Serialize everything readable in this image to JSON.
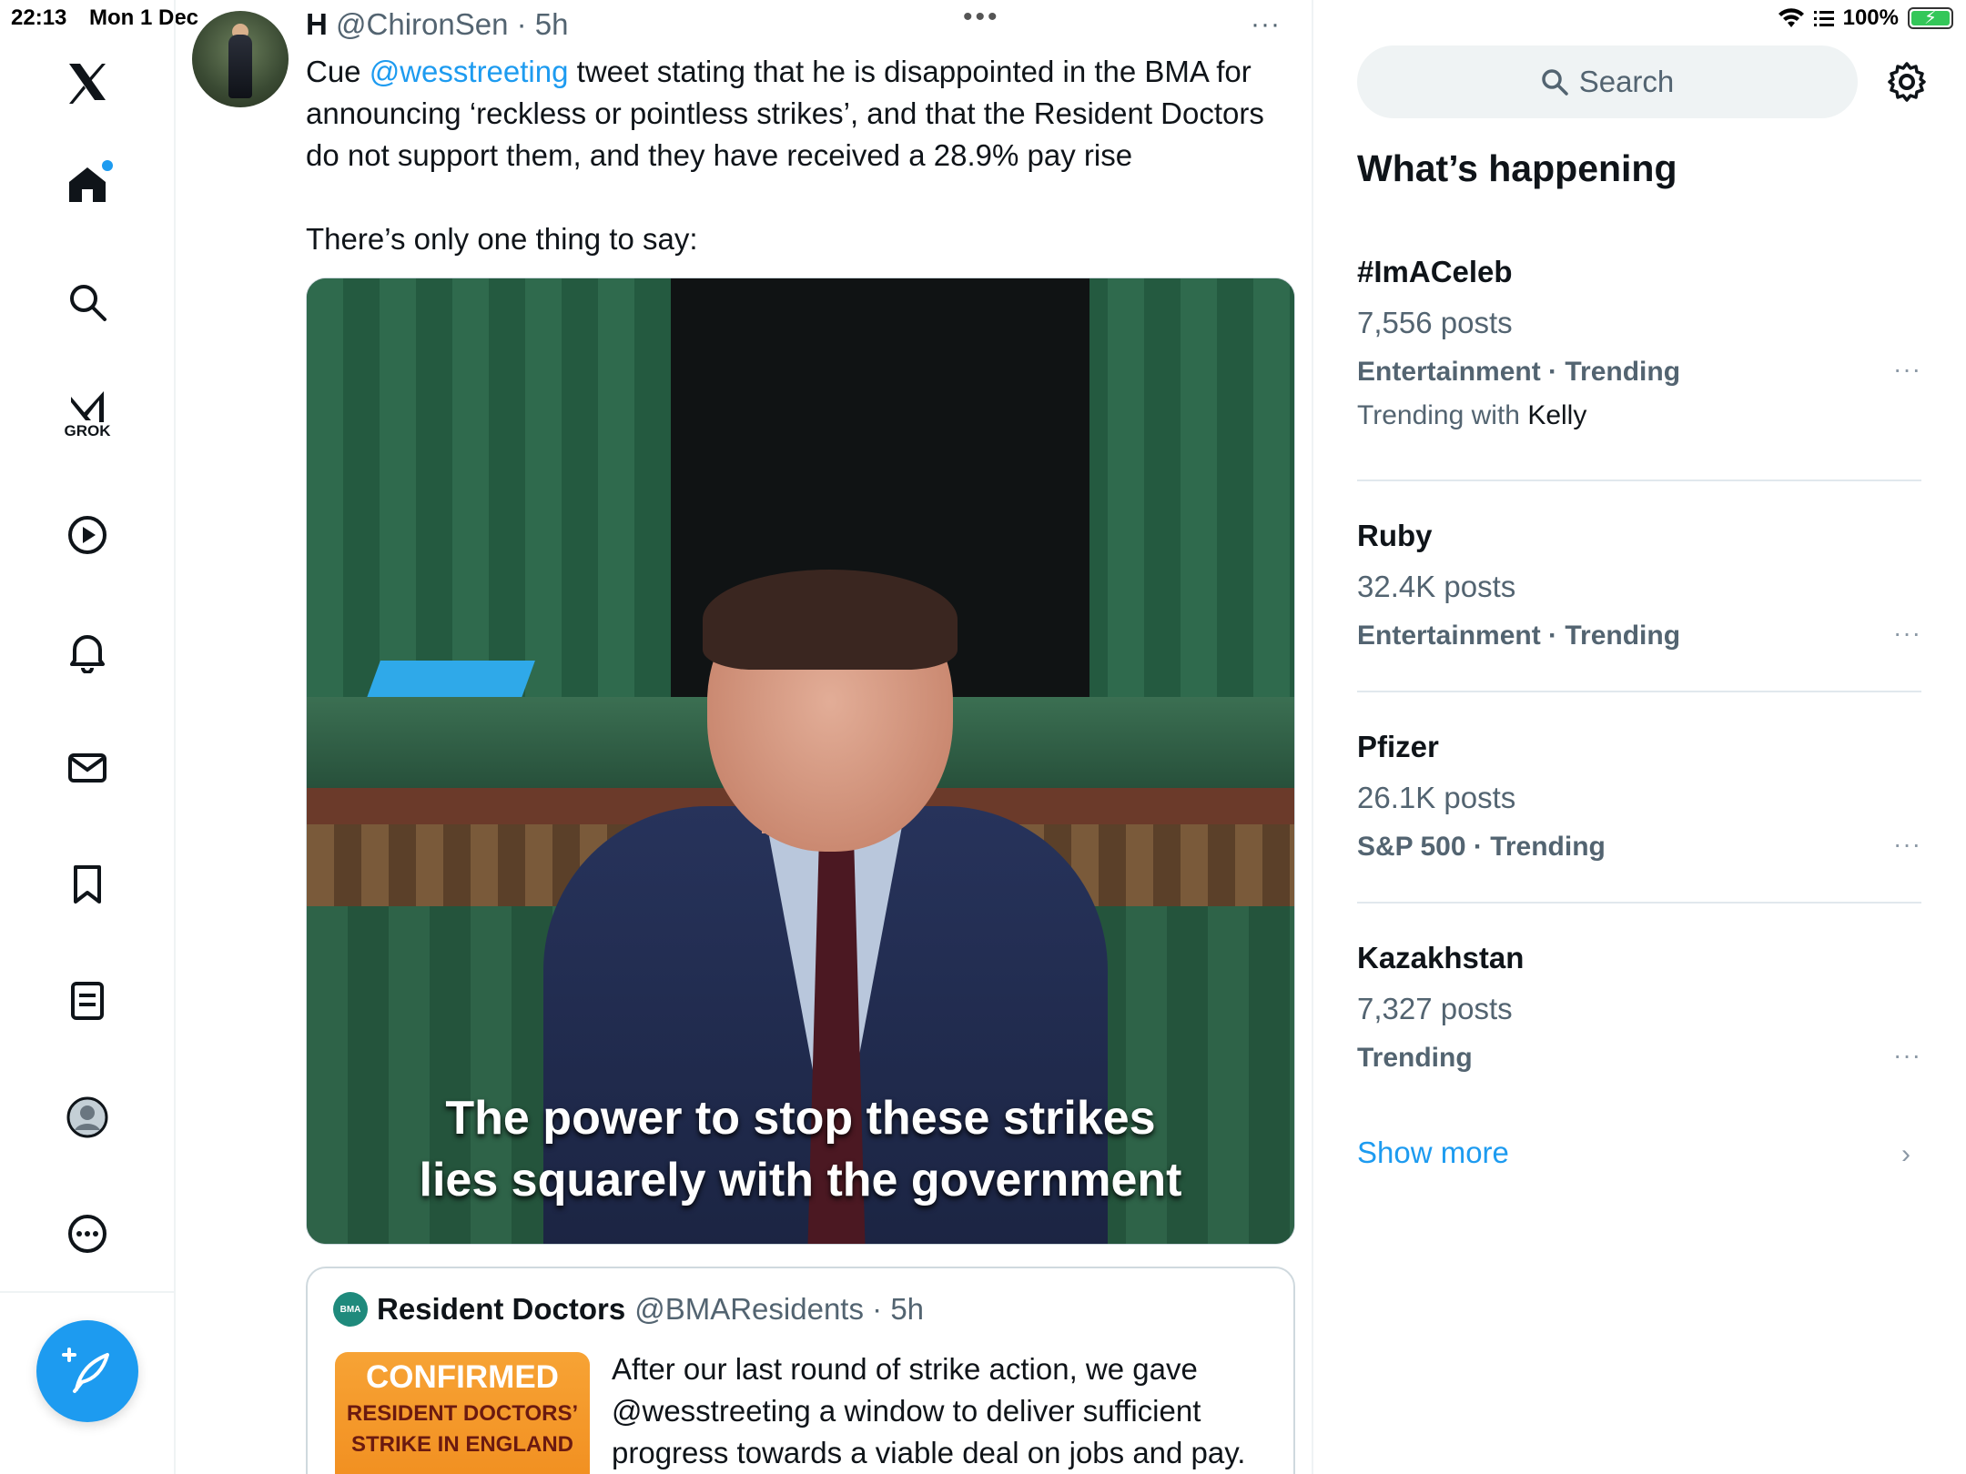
{
  "status_bar": {
    "time": "22:13",
    "date": "Mon 1 Dec",
    "center_indicator": "•••",
    "battery": "100%"
  },
  "nav": {
    "grok_label": "GROK",
    "accent_color": "#1d9bf0",
    "icons": [
      "x-logo-icon",
      "home-icon",
      "search-icon",
      "grok-icon",
      "video-icon",
      "notifications-icon",
      "messages-icon",
      "bookmark-icon",
      "lists-icon",
      "profile-icon",
      "more-icon",
      "compose-icon"
    ]
  },
  "tweet": {
    "display_name": "H",
    "handle": "@ChironSen",
    "separator": " · ",
    "time": "5h",
    "more": "···",
    "text_pre": "Cue ",
    "mention": "@wesstreeting",
    "text_post": " tweet stating that he is disappointed in the BMA for announcing ‘reckless or pointless strikes’, and that the Resident Doctors do not support them, and they have received a 28.9% pay rise",
    "text_2": "There’s only one thing to say:",
    "media_caption_line1": "The power to stop these strikes",
    "media_caption_line2": "lies squarely with the government"
  },
  "quote": {
    "logo_text": "BMA",
    "name": "Resident Doctors",
    "handle": "@BMAResidents",
    "separator": " · ",
    "time": "5h",
    "thumb_title": "CONFIRMED",
    "thumb_line1": "RESIDENT DOCTORS’",
    "thumb_line2": "STRIKE IN ENGLAND",
    "text": "After our last round of strike action, we gave @wesstreeting a window to deliver sufficient progress towards a viable deal on jobs and pay."
  },
  "sidebar": {
    "search_placeholder": "Search",
    "section_title": "What’s happening",
    "trends": [
      {
        "name": "#ImACeleb",
        "posts": "7,556 posts",
        "meta": "Entertainment · Trending",
        "with_prefix": "Trending with ",
        "with_name": "Kelly"
      },
      {
        "name": "Ruby",
        "posts": "32.4K posts",
        "meta": "Entertainment · Trending"
      },
      {
        "name": "Pfizer",
        "posts": "26.1K posts",
        "meta": "S&P 500 · Trending"
      },
      {
        "name": "Kazakhstan",
        "posts": "7,327 posts",
        "meta": "Trending"
      }
    ],
    "trend_more": "···",
    "show_more": "Show more",
    "chevron": "›"
  }
}
